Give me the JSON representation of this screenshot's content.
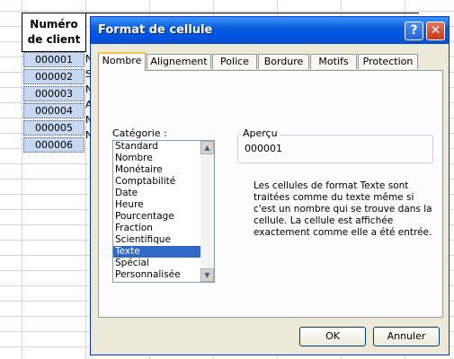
{
  "spreadsheet": {
    "header_line1": "Numéro",
    "header_line2": "de client",
    "ids": [
      "000001",
      "000002",
      "000003",
      "000004",
      "000005",
      "000006"
    ],
    "letters": [
      "N",
      "S",
      "N",
      "A",
      "N",
      "N"
    ]
  },
  "dialog": {
    "title": "Format de cellule",
    "help_icon": "?",
    "close_icon": "✕",
    "tabs": [
      "Nombre",
      "Alignement",
      "Police",
      "Bordure",
      "Motifs",
      "Protection"
    ],
    "active_tab": "Nombre",
    "category_label": "Catégorie :",
    "categories": [
      "Standard",
      "Nombre",
      "Monétaire",
      "Comptabilité",
      "Date",
      "Heure",
      "Pourcentage",
      "Fraction",
      "Scientifique",
      "Texte",
      "Spécial",
      "Personnalisée"
    ],
    "selected_category": "Texte",
    "preview_label": "Aperçu",
    "preview_value": "000001",
    "description": "Les cellules de format Texte sont traitées comme du texte même si c'est un nombre qui se trouve dans la cellule. La cellule est affichée exactement comme elle a été entrée.",
    "ok_label": "OK",
    "cancel_label": "Annuler"
  }
}
